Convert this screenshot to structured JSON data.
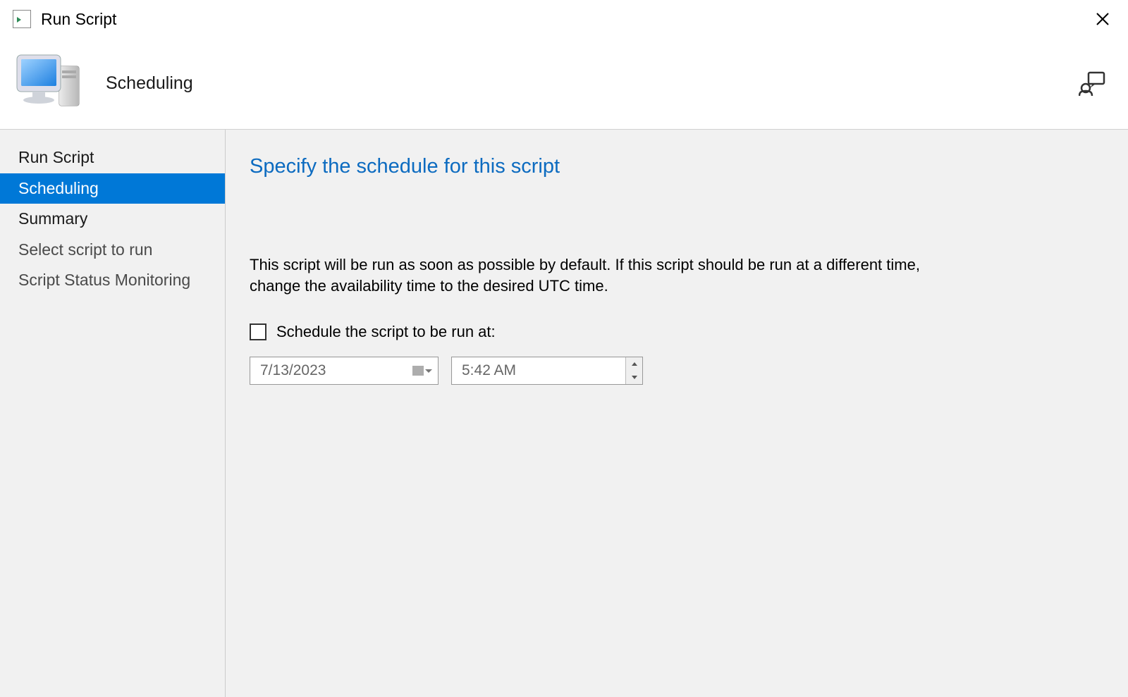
{
  "titlebar": {
    "title": "Run Script"
  },
  "header": {
    "page_title": "Scheduling"
  },
  "sidebar": {
    "items": [
      {
        "label": "Run Script",
        "selected": false,
        "secondary": false
      },
      {
        "label": "Scheduling",
        "selected": true,
        "secondary": false
      },
      {
        "label": "Summary",
        "selected": false,
        "secondary": false
      },
      {
        "label": "Select script to run",
        "selected": false,
        "secondary": true
      },
      {
        "label": "Script Status Monitoring",
        "selected": false,
        "secondary": true
      }
    ]
  },
  "content": {
    "title": "Specify the schedule for this script",
    "description": "This script will be run as soon as possible by default. If this script should be run at a different time, change the availability time to the desired UTC time.",
    "checkbox_label": "Schedule the script to be run at:",
    "checkbox_checked": false,
    "date_value": "7/13/2023",
    "time_value": "5:42 AM"
  }
}
